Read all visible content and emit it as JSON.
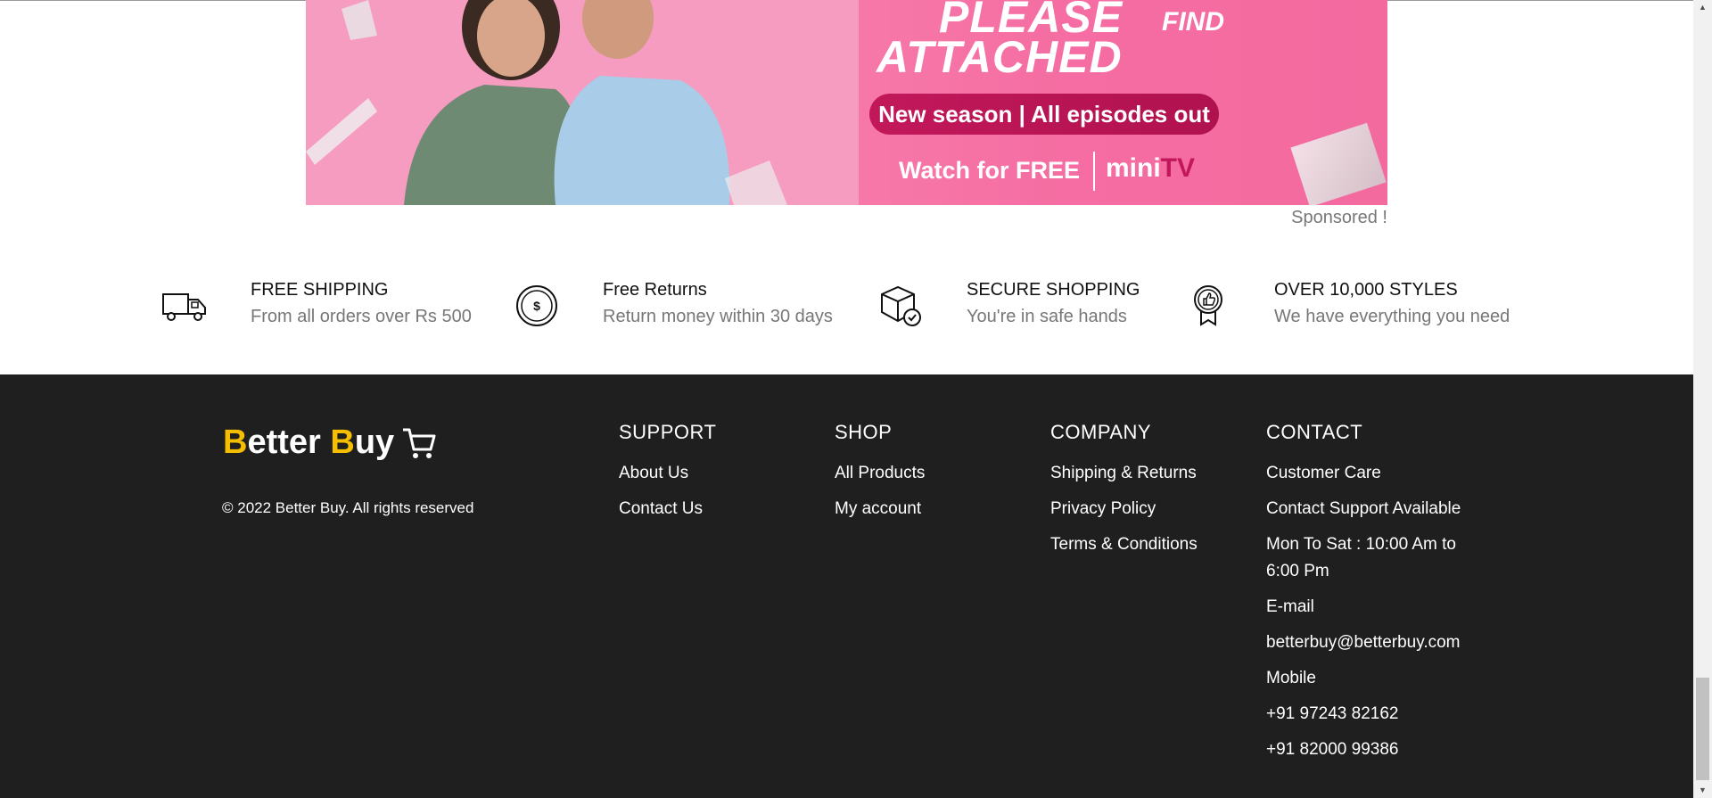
{
  "banner": {
    "headline_line1": "PLEASE",
    "headline_find": "FIND",
    "headline_line2": "ATTACHED",
    "pill_text": "New season | All episodes out",
    "watch_text": "Watch for FREE",
    "brand_mini": "mini",
    "brand_tv": "TV",
    "sponsored_label": "Sponsored !"
  },
  "features": [
    {
      "title": "FREE SHIPPING",
      "subtitle": "From all orders over Rs 500",
      "icon": "truck-icon"
    },
    {
      "title": "Free Returns",
      "subtitle": "Return money within 30 days",
      "icon": "dollar-coin-icon"
    },
    {
      "title": "SECURE SHOPPING",
      "subtitle": "You're in safe hands",
      "icon": "package-check-icon"
    },
    {
      "title": "OVER 10,000 STYLES",
      "subtitle": "We have everything you need",
      "icon": "thumbs-up-badge-icon"
    }
  ],
  "footer": {
    "logo_b1": "B",
    "logo_rest1": "etter ",
    "logo_b2": "B",
    "logo_rest2": "uy",
    "copyright": "© 2022 Better Buy. All rights reserved",
    "support": {
      "heading": "SUPPORT",
      "items": [
        "About Us",
        "Contact Us"
      ]
    },
    "shop": {
      "heading": "SHOP",
      "items": [
        "All Products",
        "My account"
      ]
    },
    "company": {
      "heading": "COMPANY",
      "items": [
        "Shipping & Returns",
        "Privacy Policy",
        "Terms & Conditions"
      ]
    },
    "contact": {
      "heading": "CONTACT",
      "items": [
        "Customer Care",
        "Contact Support Available",
        "Mon To Sat : 10:00 Am to 6:00 Pm",
        "E-mail",
        "betterbuy@betterbuy.com",
        "Mobile",
        "+91 97243 82162",
        "+91 82000 99386"
      ]
    }
  },
  "colors": {
    "logo_accent": "#f6be00",
    "footer_bg": "#1f1f1f",
    "banner_pink": "#f77fad"
  }
}
